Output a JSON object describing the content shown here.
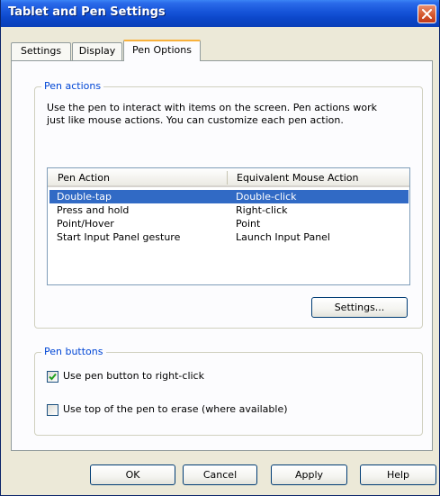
{
  "window": {
    "title": "Tablet and Pen Settings"
  },
  "tabs": [
    {
      "label": "Settings"
    },
    {
      "label": "Display"
    },
    {
      "label": "Pen Options"
    }
  ],
  "pen_actions": {
    "legend": "Pen actions",
    "description_line1": "Use the pen to interact with items on the screen. Pen actions work",
    "description_line2": "just like mouse actions. You can customize each pen action.",
    "columns": [
      "Pen Action",
      "Equivalent Mouse Action"
    ],
    "rows": [
      {
        "action": "Double-tap",
        "mouse": "Double-click",
        "selected": true
      },
      {
        "action": "Press and hold",
        "mouse": "Right-click",
        "selected": false
      },
      {
        "action": "Point/Hover",
        "mouse": "Point",
        "selected": false
      },
      {
        "action": "Start Input Panel gesture",
        "mouse": "Launch Input Panel",
        "selected": false
      }
    ],
    "settings_button": "Settings..."
  },
  "pen_buttons": {
    "legend": "Pen buttons",
    "right_click_label": "Use pen button to right-click",
    "right_click_checked": true,
    "erase_label": "Use top of the pen to erase (where available)",
    "erase_checked": false
  },
  "footer": {
    "ok": "OK",
    "cancel": "Cancel",
    "apply": "Apply",
    "help": "Help"
  },
  "colors": {
    "titlebar": "#0b46c8",
    "selection": "#316ac5",
    "groupbox_legend": "#0046d5",
    "close_button": "#d4582e"
  }
}
